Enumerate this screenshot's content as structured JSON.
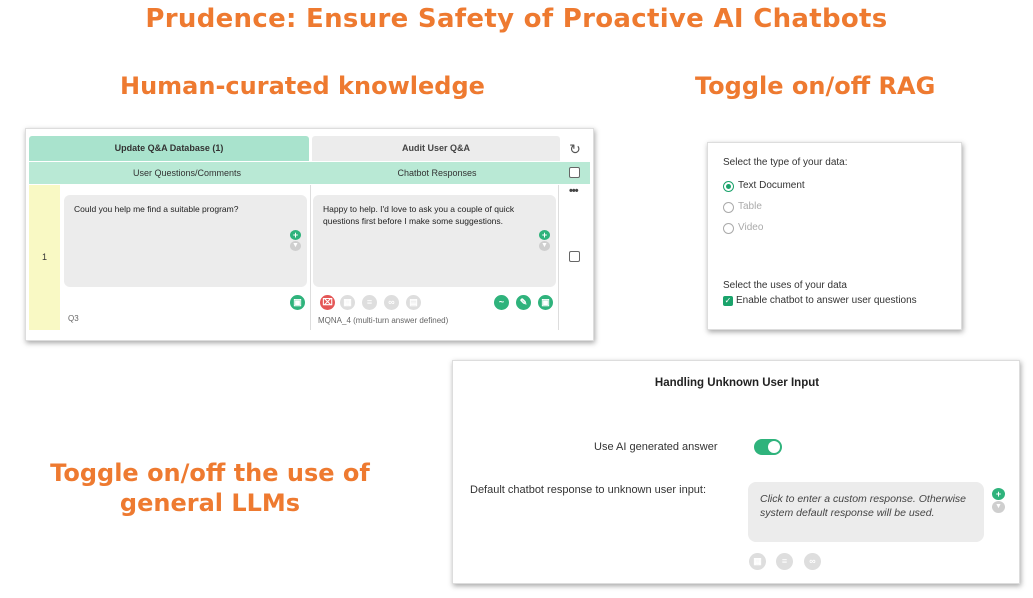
{
  "titles": {
    "main": "Prudence: Ensure Safety of Proactive AI Chatbots",
    "knowledge": "Human-curated knowledge",
    "rag": "Toggle on/off RAG",
    "llm": "Toggle on/off the use of general LLMs"
  },
  "qa_panel": {
    "tabs": [
      "Update Q&A Database (1)",
      "Audit User Q&A"
    ],
    "columns": [
      "User Questions/Comments",
      "Chatbot Responses"
    ],
    "rows": [
      {
        "number": "1",
        "question": "Could you help me find a suitable program?",
        "question_label": "Q3",
        "response": "Happy to help. I'd love to ask you a couple of quick questions first before I make some suggestions.",
        "response_label": "MQNA_4 (multi-turn answer defined)"
      }
    ],
    "more_menu": "•••"
  },
  "rag_panel": {
    "type_prompt": "Select the type of your data:",
    "data_types": [
      {
        "label": "Text Document",
        "selected": true
      },
      {
        "label": "Table",
        "selected": false
      },
      {
        "label": "Video",
        "selected": false
      }
    ],
    "uses_prompt": "Select the uses of your data",
    "uses_option": "Enable chatbot to answer user questions",
    "uses_checked": true
  },
  "unknown_panel": {
    "title": "Handling Unknown User Input",
    "ai_label": "Use AI generated answer",
    "ai_enabled": true,
    "default_label": "Default chatbot response to unknown user input:",
    "default_placeholder": "Click to enter a custom response. Otherwise system default response will be used."
  },
  "colors": {
    "accent_orange": "#ee7a30",
    "green": "#2fb37c",
    "tab_green": "#a9e3cd",
    "row_yellow": "#f9f9c4"
  }
}
